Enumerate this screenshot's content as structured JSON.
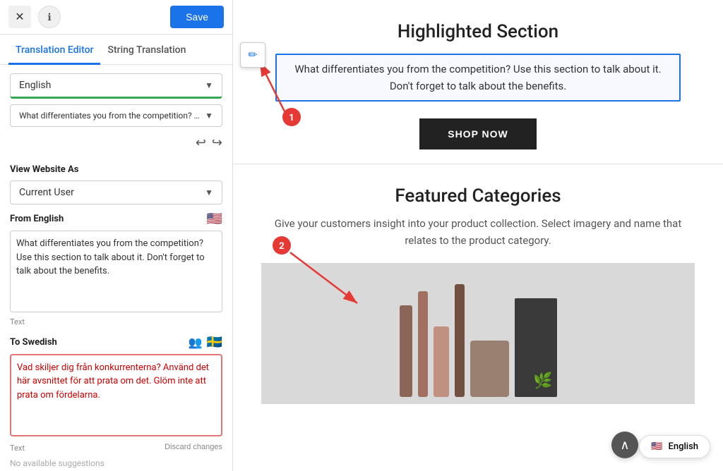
{
  "topbar": {
    "close_label": "✕",
    "info_label": "ℹ",
    "save_label": "Save"
  },
  "tabs": {
    "tab1": "Translation Editor",
    "tab2": "String Translation",
    "active": "tab1"
  },
  "language_dropdown": {
    "value": "English",
    "placeholder": "English"
  },
  "string_dropdown": {
    "value": "What differentiates you from the competition? Use...",
    "placeholder": "What differentiates you from the competition? Use..."
  },
  "view_as": {
    "label": "View Website As",
    "dropdown_value": "Current User"
  },
  "from_english": {
    "label": "From English",
    "flag": "🇺🇸",
    "text": "What differentiates you from the competition? Use this section to talk about it. Don't forget to talk about the benefits.",
    "field_type": "Text"
  },
  "to_swedish": {
    "label": "To Swedish",
    "flag": "🇸🇪",
    "add_icon": "👥",
    "text": "Vad skiljer dig från konkurrenterna? Använd det här avsnittet för att prata om det. Glöm inte att prata om fördelarna.",
    "field_type": "Text",
    "discard_label": "Discard changes"
  },
  "no_suggestions": "No available suggestions",
  "main_content": {
    "highlighted_section_title": "Highlighted Section",
    "highlighted_section_text": "What differentiates you from the competition? Use this section to talk about it. Don't forget to talk about the benefits.",
    "shop_now_label": "SHOP NOW",
    "featured_title": "Featured Categories",
    "featured_desc": "Give your customers insight into your product collection. Select imagery and name that relates to the product category."
  },
  "english_badge": {
    "flag": "🇺🇸",
    "label": "English"
  },
  "badge_numbers": {
    "b1": "1",
    "b2": "2"
  }
}
